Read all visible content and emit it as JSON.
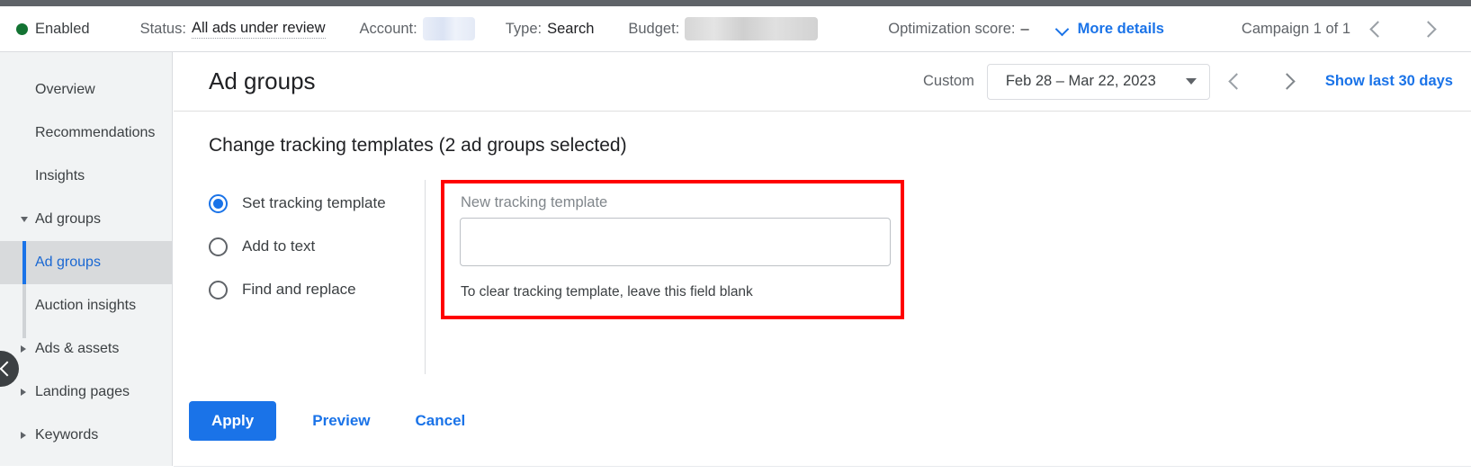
{
  "campaign_bar": {
    "status_dot_label": "Enabled",
    "status_dot_color": "#137333",
    "status_key": "Status:",
    "status_value": "All ads under review",
    "account_key": "Account:",
    "account_value_masked": "",
    "type_key": "Type:",
    "type_value": "Search",
    "budget_key": "Budget:",
    "budget_value_masked": "",
    "optimization_key": "Optimization score:",
    "optimization_value": "–",
    "more_details_label": "More details",
    "campaign_counter": "Campaign 1 of 1",
    "link_color": "#1a73e8"
  },
  "sidebar": {
    "items": [
      {
        "label": "Overview",
        "type": "link",
        "selected": false
      },
      {
        "label": "Recommendations",
        "type": "link",
        "selected": false
      },
      {
        "label": "Insights",
        "type": "link",
        "selected": false
      },
      {
        "label": "Ad groups",
        "type": "group-expanded",
        "selected": false
      },
      {
        "label": "Ad groups",
        "type": "sub",
        "selected": true
      },
      {
        "label": "Auction insights",
        "type": "sub",
        "selected": false
      },
      {
        "label": "Ads & assets",
        "type": "group-collapsed",
        "selected": false
      },
      {
        "label": "Landing pages",
        "type": "group-collapsed",
        "selected": false
      },
      {
        "label": "Keywords",
        "type": "group-collapsed",
        "selected": false
      }
    ],
    "selected_accent": "#1a73e8"
  },
  "page_header": {
    "title": "Ad groups",
    "date_mode_label": "Custom",
    "date_range": "Feb 28 – Mar 22, 2023",
    "show_last_label": "Show last 30 days"
  },
  "main": {
    "section_title": "Change tracking templates (2 ad groups selected)",
    "options": [
      {
        "label": "Set tracking template",
        "selected": true
      },
      {
        "label": "Add to text",
        "selected": false
      },
      {
        "label": "Find and replace",
        "selected": false
      }
    ],
    "panel": {
      "field_label": "New tracking template",
      "field_value": "",
      "field_placeholder": "",
      "hint": "To clear tracking template, leave this field blank",
      "highlight_color": "#ff0000"
    },
    "actions": {
      "apply_label": "Apply",
      "preview_label": "Preview",
      "cancel_label": "Cancel"
    }
  }
}
